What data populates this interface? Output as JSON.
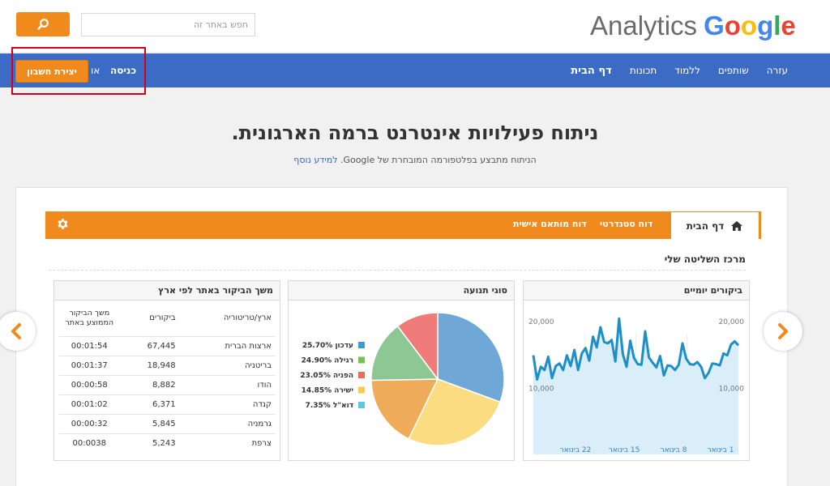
{
  "search": {
    "placeholder": "חפש באתר זה"
  },
  "logo": {
    "analytics": "Analytics",
    "google": [
      "G",
      "o",
      "o",
      "g",
      "l",
      "e"
    ],
    "google_colors": [
      "#4285f4",
      "#ea4335",
      "#fbbc05",
      "#4285f4",
      "#34a853",
      "#ea4335"
    ]
  },
  "nav": {
    "items": [
      "דף הבית",
      "תכונות",
      "ללמוד",
      "שותפים",
      "עזרה"
    ],
    "create_account": "יצירת חשבון",
    "or": "או",
    "login": "כניסה"
  },
  "hero": {
    "title": "ניתוח פעילויות אינטרנט ברמה הארגונית.",
    "subtitle": "הניתוח מתבצע בפלטפורמה המובחרת של Google.",
    "learn_more": "למידע נוסף"
  },
  "tabs": {
    "home": "דף הבית",
    "standard": "דוח סטנדרטי",
    "custom": "דוח מותאם אישית"
  },
  "dashboard": {
    "title": "מרכז השליטה שלי"
  },
  "panels": {
    "visits": "ביקורים יומיים",
    "traffic": "סוגי תנועה",
    "country": "משך הביקור באתר לפי ארץ"
  },
  "colors": {
    "accent": "#f18a1c",
    "nav": "#3b6bc4",
    "line": "#1e8fc6",
    "area": "#d9eef8"
  },
  "chart_data": [
    {
      "type": "area",
      "title": "ביקורים יומיים",
      "y_tick_labels": [
        "20,000",
        "10,000"
      ],
      "x_tick_labels": [
        "1 בינואר",
        "8 בינואר",
        "15 בינואר",
        "22 בינואר"
      ],
      "ylim": [
        0,
        23000
      ],
      "values": [
        14800,
        11200,
        13100,
        12600,
        14600,
        11400,
        13200,
        13600,
        12600,
        14800,
        13200,
        15600,
        12600,
        15100,
        15900,
        14000,
        17600,
        16000,
        19000,
        16800,
        16600,
        17100,
        13900,
        20300,
        15000,
        13100,
        17000,
        14400,
        13500,
        13400,
        18400,
        14500,
        13700,
        13000,
        14700,
        11800,
        13300,
        13200,
        12600,
        13400,
        16600,
        14300,
        13500,
        13400,
        13800,
        13100,
        11400,
        12200,
        13600,
        13500,
        13300,
        15100,
        14800,
        16400,
        16900,
        16300
      ],
      "y_label_values": [
        20000,
        10000
      ]
    },
    {
      "type": "pie",
      "title": "סוגי תנועה",
      "slices": [
        {
          "label": "עדכון",
          "pct_label": "25.70%",
          "value": 25.7,
          "color": "#3e9bd2"
        },
        {
          "label": "רגילה",
          "pct_label": "24.90%",
          "value": 24.9,
          "color": "#7fbf4d"
        },
        {
          "label": "הפניה",
          "pct_label": "23.05%",
          "value": 23.05,
          "color": "#ec6b5e"
        },
        {
          "label": "ישירה",
          "pct_label": "14.85%",
          "value": 14.85,
          "color": "#f5cb4d"
        },
        {
          "label": "דוא\"ל",
          "pct_label": "7.35%",
          "value": 7.35,
          "color": "#5ec6e6"
        }
      ],
      "pie_order": [
        {
          "value": 30.6,
          "color": "#6fa8d6"
        },
        {
          "value": 26.6,
          "color": "#fbdc80"
        },
        {
          "value": 17.5,
          "color": "#f0ab5a"
        },
        {
          "value": 15.0,
          "color": "#8dc793"
        },
        {
          "value": 10.3,
          "color": "#f07b7b"
        }
      ]
    },
    {
      "type": "table",
      "title": "משך הביקור באתר לפי ארץ",
      "columns": [
        "ארץ/טריטוריה",
        "ביקורים",
        "משך הביקור הממוצע באתר"
      ],
      "rows": [
        [
          "ארצות הברית",
          "67,445",
          "00:01:54"
        ],
        [
          "בריטניה",
          "18,948",
          "00:01:37"
        ],
        [
          "הודו",
          "8,882",
          "00:00:58"
        ],
        [
          "קנדה",
          "6,371",
          "00:01:02"
        ],
        [
          "גרמניה",
          "5,845",
          "00:00:32"
        ],
        [
          "צרפת",
          "5,243",
          "00:0038"
        ]
      ]
    }
  ]
}
